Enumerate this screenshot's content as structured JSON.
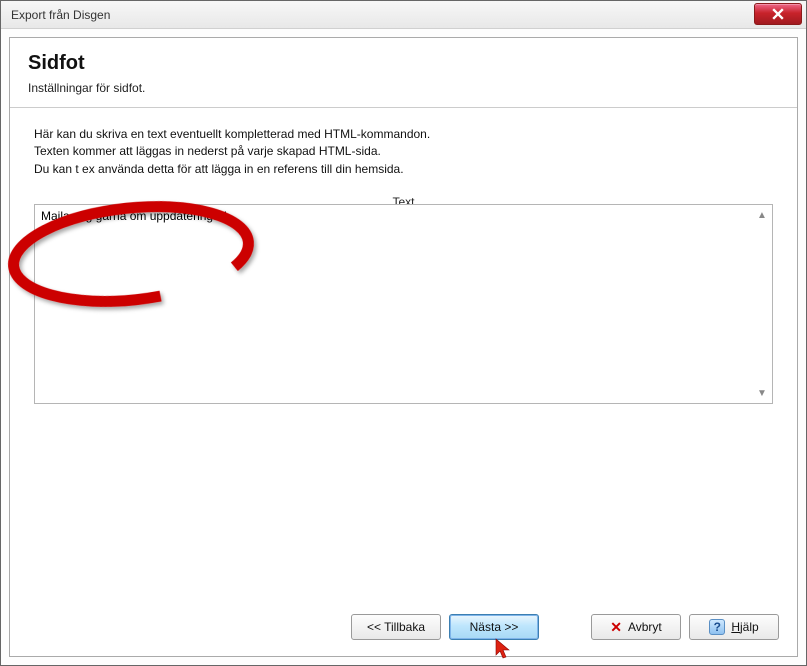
{
  "window": {
    "title": "Export från Disgen"
  },
  "header": {
    "title": "Sidfot",
    "subtitle": "Inställningar för sidfot."
  },
  "instructions": {
    "line1": "Här kan du skriva en text eventuellt kompletterad med HTML-kommandon.",
    "line2": "Texten kommer att läggas in nederst på varje skapad HTML-sida.",
    "line3": "Du kan t ex använda detta för att lägga in en referens till din hemsida."
  },
  "field": {
    "label_pre": "Te",
    "label_hot": "x",
    "label_post": "t",
    "value": "Maila mig gärna om uppdateringar!"
  },
  "buttons": {
    "back": "<< Tillbaka",
    "next": "Nästa >>",
    "cancel": "Avbryt",
    "help_hot": "H",
    "help_rest": "jälp"
  }
}
